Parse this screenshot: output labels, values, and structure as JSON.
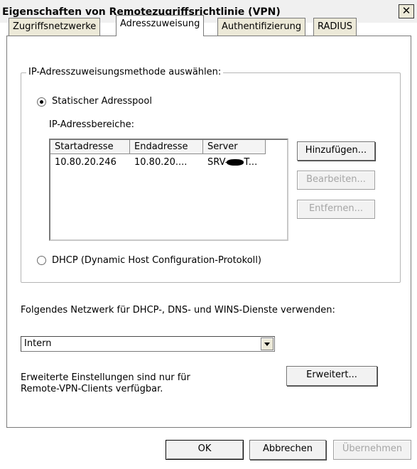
{
  "window": {
    "title": "Eigenschaften von Remotezugriffsrichtlinie (VPN)",
    "close_glyph": "✕"
  },
  "tabs": [
    {
      "label": "Zugriffsnetzwerke",
      "active": false
    },
    {
      "label": "Adresszuweisung",
      "active": true
    },
    {
      "label": "Authentifizierung",
      "active": false
    },
    {
      "label": "RADIUS",
      "active": false
    }
  ],
  "group": {
    "legend": "IP-Adresszuweisungsmethode auswählen:",
    "static_option": {
      "label": "Statischer Adresspool",
      "selected": true
    },
    "ranges_label": "IP-Adressbereiche:",
    "columns": [
      "Startadresse",
      "Endadresse",
      "Server"
    ],
    "rows": [
      {
        "start": "10.80.20.246",
        "end": "10.80.20....",
        "server_prefix": "SRV-",
        "server_suffix": "T..."
      }
    ],
    "buttons": {
      "add": "Hinzufügen...",
      "edit": "Bearbeiten...",
      "remove": "Entfernen..."
    },
    "dhcp_option": {
      "label": "DHCP (Dynamic Host Configuration-Protokoll)",
      "selected": false
    }
  },
  "network": {
    "label": "Folgendes Netzwerk für DHCP-, DNS- und WINS-Dienste verwenden:",
    "selected": "Intern"
  },
  "advanced": {
    "text_line1": "Erweiterte Einstellungen sind nur für",
    "text_line2": "Remote-VPN-Clients verfügbar.",
    "button": "Erweitert..."
  },
  "footer": {
    "ok": "OK",
    "cancel": "Abbrechen",
    "apply": "Übernehmen"
  }
}
